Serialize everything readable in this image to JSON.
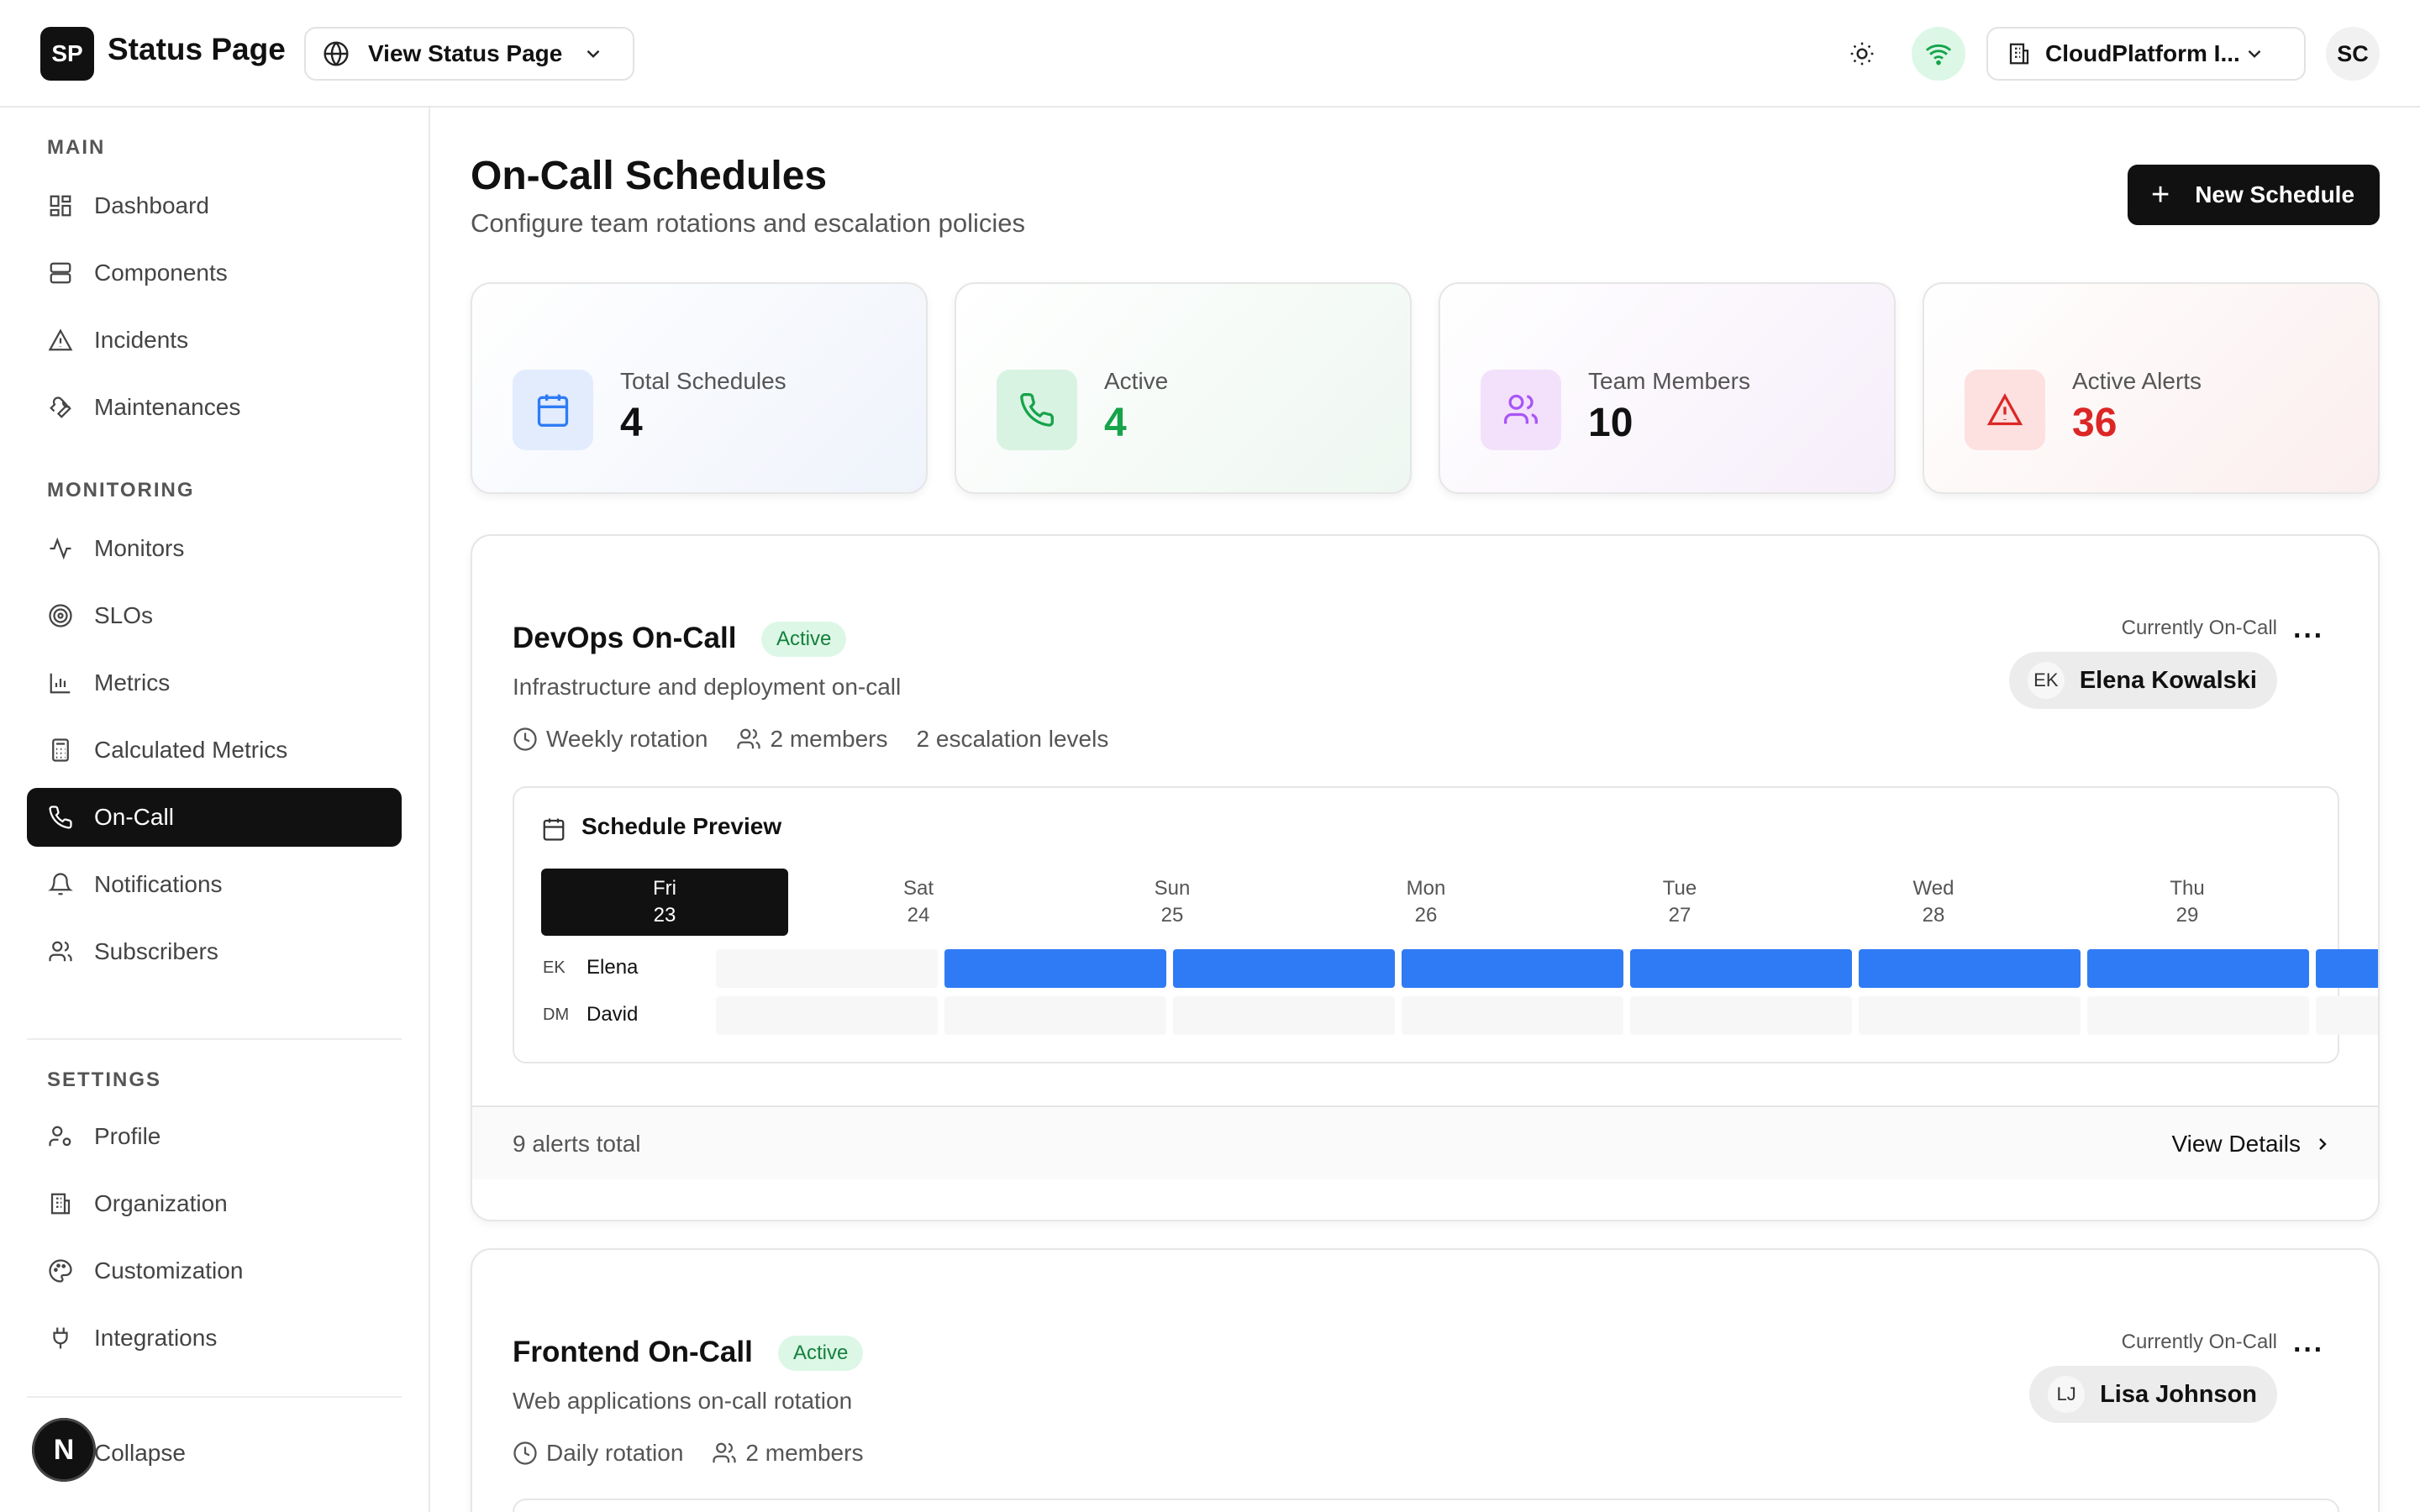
{
  "app": {
    "logo": "SP",
    "title": "Status Page"
  },
  "header": {
    "view_status_label": "View Status Page",
    "org_name": "CloudPlatform I...",
    "user_initials": "SC"
  },
  "sidebar": {
    "main_label": "MAIN",
    "main_items": [
      {
        "label": "Dashboard",
        "icon": "dashboard-icon"
      },
      {
        "label": "Components",
        "icon": "components-icon"
      },
      {
        "label": "Incidents",
        "icon": "alert-triangle-icon"
      },
      {
        "label": "Maintenances",
        "icon": "wrench-icon"
      }
    ],
    "monitoring_label": "MONITORING",
    "monitoring_items": [
      {
        "label": "Monitors",
        "icon": "activity-icon"
      },
      {
        "label": "SLOs",
        "icon": "target-icon"
      },
      {
        "label": "Metrics",
        "icon": "bar-chart-icon"
      },
      {
        "label": "Calculated Metrics",
        "icon": "calculator-icon"
      },
      {
        "label": "On-Call",
        "icon": "phone-icon",
        "active": true
      },
      {
        "label": "Notifications",
        "icon": "bell-icon"
      },
      {
        "label": "Subscribers",
        "icon": "users-icon"
      }
    ],
    "settings_label": "SETTINGS",
    "settings_items": [
      {
        "label": "Profile",
        "icon": "user-cog-icon"
      },
      {
        "label": "Organization",
        "icon": "building-icon"
      },
      {
        "label": "Customization",
        "icon": "palette-icon"
      },
      {
        "label": "Integrations",
        "icon": "plug-icon"
      }
    ],
    "collapse_label": "Collapse",
    "badge": "N"
  },
  "page": {
    "title": "On-Call Schedules",
    "subtitle": "Configure team rotations and escalation policies",
    "new_button": "New Schedule"
  },
  "stats": [
    {
      "label": "Total Schedules",
      "value": "4",
      "color": "#111111",
      "bg": "#e6efff",
      "icon": "calendar-icon"
    },
    {
      "label": "Active",
      "value": "4",
      "color": "#16a34a",
      "bg": "#dcf7e6",
      "icon": "phone-icon"
    },
    {
      "label": "Team Members",
      "value": "10",
      "color": "#111111",
      "bg": "#f3e3fb",
      "icon": "users-icon"
    },
    {
      "label": "Active Alerts",
      "value": "36",
      "color": "#dc2626",
      "bg": "#fde3e3",
      "icon": "alert-triangle-icon"
    }
  ],
  "schedules": [
    {
      "name": "DevOps On-Call",
      "status": "Active",
      "description": "Infrastructure and deployment on-call",
      "rotation": "Weekly rotation",
      "members": "2 members",
      "escalation": "2 escalation levels",
      "oncall_label": "Currently On-Call",
      "oncall_initials": "EK",
      "oncall_name": "Elena Kowalski",
      "preview_title": "Schedule Preview",
      "days": [
        {
          "day": "Fri",
          "date": "23",
          "today": true
        },
        {
          "day": "Sat",
          "date": "24"
        },
        {
          "day": "Sun",
          "date": "25"
        },
        {
          "day": "Mon",
          "date": "26"
        },
        {
          "day": "Tue",
          "date": "27"
        },
        {
          "day": "Wed",
          "date": "28"
        },
        {
          "day": "Thu",
          "date": "29"
        }
      ],
      "people": [
        {
          "initials": "EK",
          "name": "Elena",
          "on": [
            false,
            true,
            true,
            true,
            true,
            true,
            true,
            true
          ]
        },
        {
          "initials": "DM",
          "name": "David",
          "on": [
            false,
            false,
            false,
            false,
            false,
            false,
            false,
            false
          ]
        }
      ],
      "alerts_total": "9 alerts total",
      "view_details": "View Details"
    },
    {
      "name": "Frontend On-Call",
      "status": "Active",
      "description": "Web applications on-call rotation",
      "rotation": "Daily rotation",
      "members": "2 members",
      "oncall_label": "Currently On-Call",
      "oncall_initials": "LJ",
      "oncall_name": "Lisa Johnson"
    }
  ]
}
